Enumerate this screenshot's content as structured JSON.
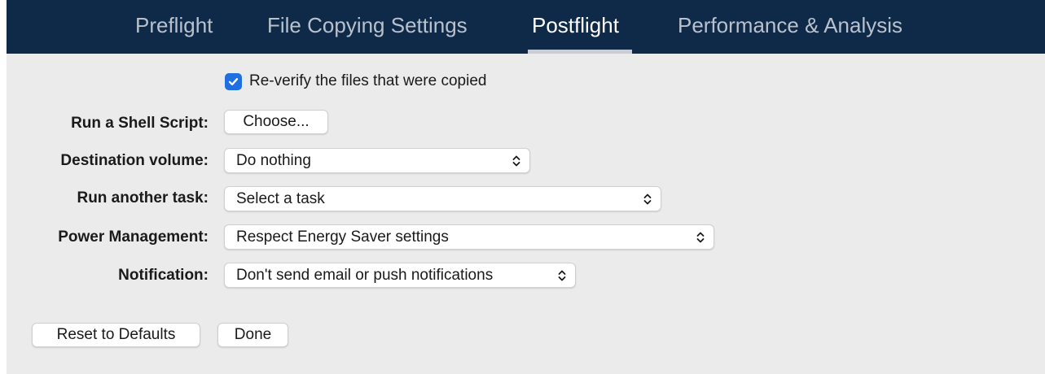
{
  "tabs": [
    {
      "label": "Preflight"
    },
    {
      "label": "File Copying Settings"
    },
    {
      "label": "Postflight",
      "active": true
    },
    {
      "label": "Performance & Analysis"
    }
  ],
  "reverify": {
    "label": "Re-verify the files that were copied",
    "checked": true
  },
  "shell_script": {
    "label": "Run a Shell Script:",
    "button": "Choose..."
  },
  "destination_volume": {
    "label": "Destination volume:",
    "value": "Do nothing"
  },
  "another_task": {
    "label": "Run another task:",
    "value": "Select a task"
  },
  "power_management": {
    "label": "Power Management:",
    "value": "Respect Energy Saver settings"
  },
  "notification": {
    "label": "Notification:",
    "value": "Don't send email or push notifications"
  },
  "footer": {
    "reset_label": "Reset to Defaults",
    "done_label": "Done"
  },
  "colors": {
    "tabbar_bg": "#0f2a48",
    "accent": "#1f6fe0",
    "window_bg": "#ebebeb"
  },
  "icons": {
    "checkbox": "checkmark-icon",
    "select": "chevron-updown-icon"
  }
}
